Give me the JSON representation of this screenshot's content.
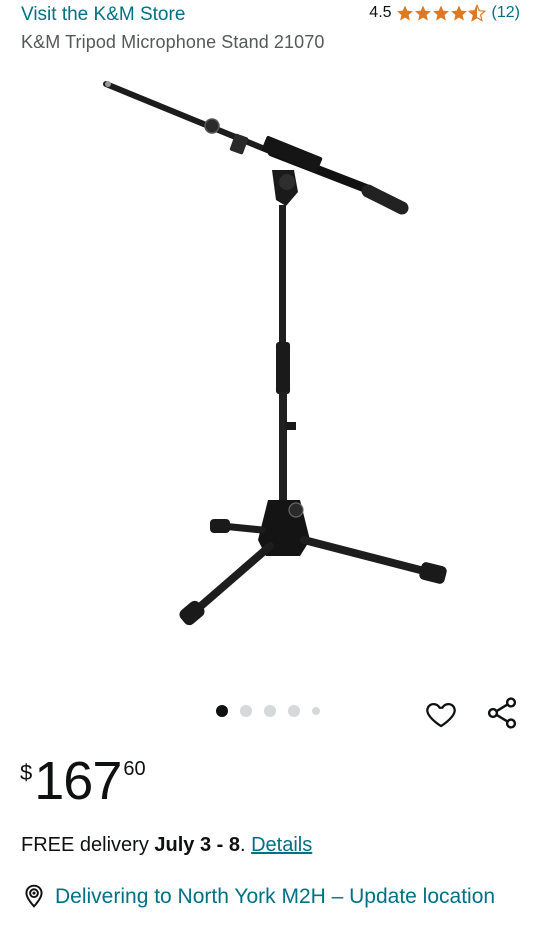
{
  "header": {
    "store_link": "Visit the K&M Store",
    "rating_value": "4.5",
    "rating_count": "(12)",
    "stars": 4.5
  },
  "product": {
    "title": "K&M Tripod Microphone Stand 21070"
  },
  "carousel": {
    "active_index": 0,
    "total": 5
  },
  "price": {
    "symbol": "$",
    "whole": "167",
    "fraction": "60"
  },
  "delivery": {
    "prefix": "FREE delivery ",
    "dates": "July 3 - 8",
    "suffix": ". ",
    "details_link": "Details"
  },
  "location": {
    "text": "Delivering to North York M2H – Update location"
  },
  "icons": {
    "wishlist": "heart-icon",
    "share": "share-icon",
    "location": "location-pin-icon"
  },
  "colors": {
    "link": "#007185",
    "star": "#de7921",
    "text": "#0f1111"
  }
}
